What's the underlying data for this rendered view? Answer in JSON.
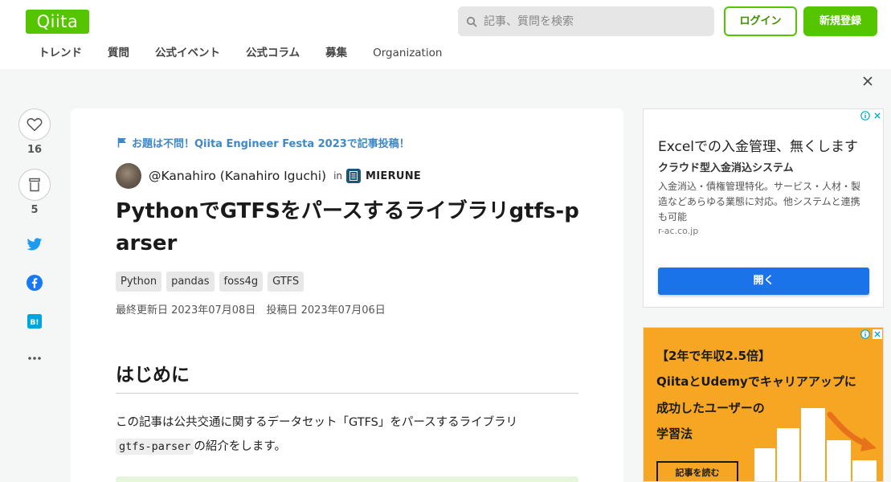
{
  "header": {
    "logo": "Qiita",
    "search_placeholder": "記事、質問を検索",
    "login_label": "ログイン",
    "signup_label": "新規登録",
    "nav": [
      "トレンド",
      "質問",
      "公式イベント",
      "公式コラム",
      "募集",
      "Organization"
    ]
  },
  "actions": {
    "like_count": "16",
    "stock_count": "5",
    "colors": {
      "twitter": "#1d9bf0",
      "facebook": "#1877f2",
      "hatena": "#00a4de"
    }
  },
  "article": {
    "event_banner": "お題は不問！Qiita Engineer Festa 2023で記事投稿！",
    "author": "@Kanahiro (Kanahiro Iguchi)",
    "in_label": "in",
    "org": "MIERUNE",
    "title": "PythonでGTFSをパースするライブラリgtfs-parser",
    "tags": [
      "Python",
      "pandas",
      "foss4g",
      "GTFS"
    ],
    "updated": "最終更新日 2023年07月08日",
    "posted": "投稿日 2023年07月06日",
    "heading": "はじめに",
    "para_text": "この記事は公共交通に関するデータセット「GTFS」をパースするライブラリ",
    "para_code": "gtfs-parser",
    "para_tail": "の紹介をします。"
  },
  "ad1": {
    "title": "Excelでの入金管理、無くします",
    "subtitle": "クラウド型入金消込システム",
    "description": "入金消込・債権管理特化。サービス・人材・製造などあらゆる業態に対応。他システムと連携も可能",
    "domain": "r-ac.co.jp",
    "button": "開く"
  },
  "ad2": {
    "line1": "【2年で年収2.5倍】",
    "line2": "QiitaとUdemyでキャリアアップに",
    "line3": "成功したユーザーの",
    "line4": "学習法",
    "button": "記事を読む"
  },
  "colors": {
    "brand": "#55c500",
    "link": "#3f88c7",
    "ad_button": "#1a73e8",
    "ad2_bg": "#f6a623"
  }
}
